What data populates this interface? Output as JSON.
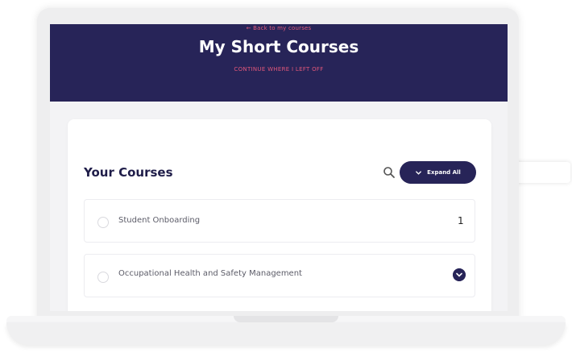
{
  "header": {
    "back_link": "← Back to my courses",
    "title": "My Short Courses",
    "continue_link": "CONTINUE WHERE I LEFT OFF"
  },
  "courses_panel": {
    "title": "Your Courses",
    "search_icon": "search-icon",
    "expand_all_label": "Expand All",
    "rows": [
      {
        "name": "Student Onboarding",
        "indicator": "1"
      },
      {
        "name": "Occupational Health and Safety Management",
        "indicator_icon": "chevron-down-icon"
      }
    ]
  },
  "colors": {
    "brand_navy": "#272458",
    "accent_pink": "#e05b7b",
    "title_navy": "#1f1d49"
  }
}
